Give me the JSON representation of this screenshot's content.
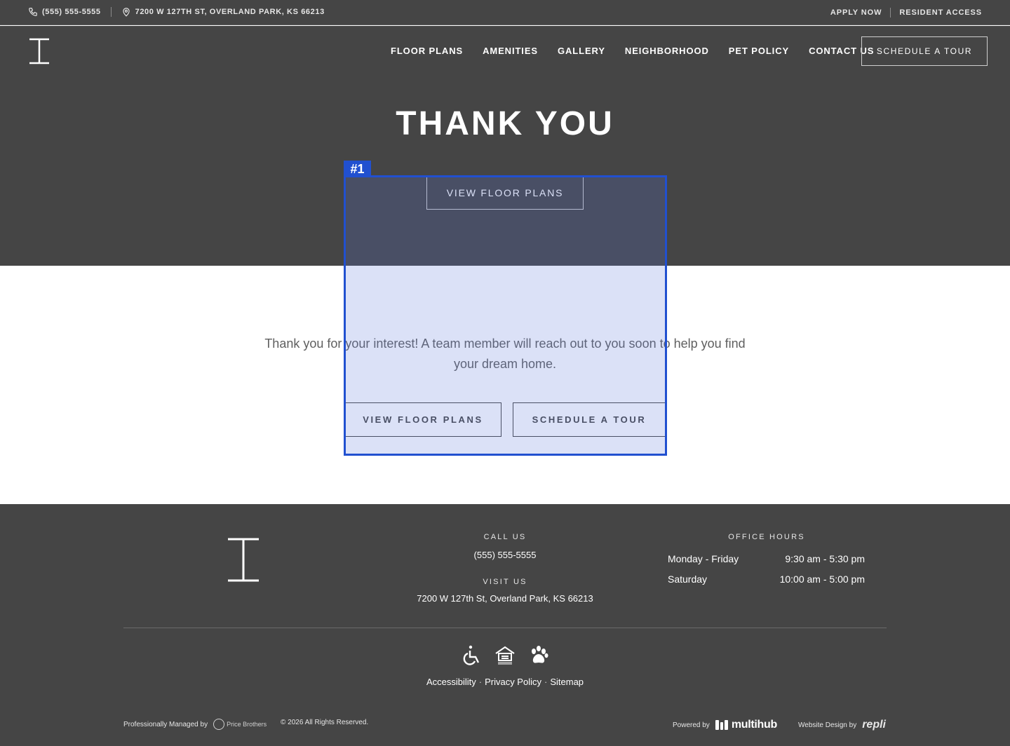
{
  "topbar": {
    "phone": "(555) 555-5555",
    "address": "7200 W 127TH ST, OVERLAND PARK, KS 66213",
    "apply_now": "APPLY NOW",
    "resident_access": "RESIDENT ACCESS"
  },
  "nav": {
    "items": [
      {
        "label": "FLOOR PLANS"
      },
      {
        "label": "AMENITIES"
      },
      {
        "label": "GALLERY"
      },
      {
        "label": "NEIGHBORHOOD"
      },
      {
        "label": "PET POLICY"
      },
      {
        "label": "CONTACT US"
      }
    ],
    "cta": "SCHEDULE A TOUR"
  },
  "hero": {
    "title": "THANK YOU",
    "button": "VIEW FLOOR PLANS"
  },
  "main": {
    "message": "Thank you for your interest! A team member will reach out to you soon to help you find your dream home.",
    "btn_floor_plans": "VIEW FLOOR PLANS",
    "btn_schedule": "SCHEDULE A TOUR"
  },
  "annotation": {
    "tag": "#1",
    "color": "#2150d0"
  },
  "footer": {
    "call_label": "CALL US",
    "phone": "(555) 555-5555",
    "visit_label": "VISIT US",
    "address": "7200 W 127th St, Overland Park, KS 66213",
    "hours_label": "OFFICE HOURS",
    "hours": [
      {
        "day": "Monday - Friday",
        "time": "9:30 am - 5:30 pm"
      },
      {
        "day": "Saturday",
        "time": "10:00 am - 5:00 pm"
      }
    ],
    "icons": [
      "accessibility-icon",
      "equal-housing-icon",
      "pet-paw-icon"
    ],
    "links": {
      "accessibility": "Accessibility",
      "privacy": "Privacy Policy",
      "sitemap": "Sitemap",
      "separator": "·"
    },
    "managed_by": "Professionally Managed by",
    "manager_name": "Price Brothers",
    "copyright": "© 2026 All Rights Reserved.",
    "powered_by": "Powered by",
    "platform": "multihub",
    "design_by": "Website Design by",
    "designer": "repli"
  },
  "colors": {
    "dark_bg": "#454545",
    "highlight": "#2150d0",
    "text_gray": "#5f5f5f"
  }
}
